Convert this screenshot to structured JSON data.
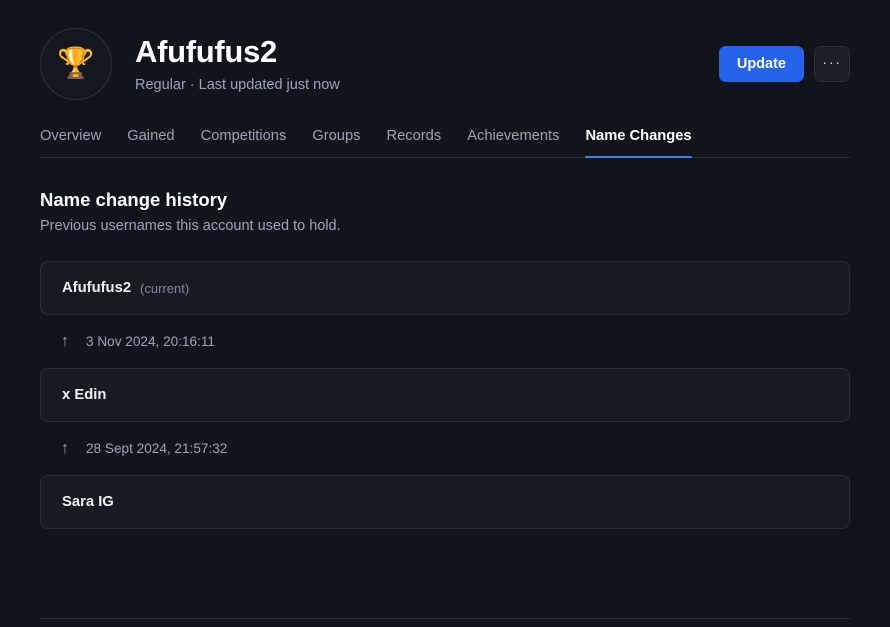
{
  "profile": {
    "avatar_icon": "trophy-icon",
    "avatar_glyph": "🏆",
    "username": "Afufufus2",
    "subtitle": "Regular · Last updated just now"
  },
  "header_actions": {
    "update_label": "Update",
    "more_label": "···",
    "more_icon": "ellipsis-icon",
    "accent_color": "#2563eb"
  },
  "tabs": [
    {
      "label": "Overview",
      "active": false
    },
    {
      "label": "Gained",
      "active": false
    },
    {
      "label": "Competitions",
      "active": false
    },
    {
      "label": "Groups",
      "active": false
    },
    {
      "label": "Records",
      "active": false
    },
    {
      "label": "Achievements",
      "active": false
    },
    {
      "label": "Name Changes",
      "active": true
    }
  ],
  "section": {
    "title": "Name change history",
    "description": "Previous usernames this account used to hold."
  },
  "history": {
    "arrow_icon": "arrow-up-icon",
    "arrow_glyph": "↑",
    "entries": [
      {
        "name": "Afufufus2",
        "tag": "(current)"
      },
      {
        "name": "x Edin",
        "tag": ""
      },
      {
        "name": "Sara IG",
        "tag": ""
      }
    ],
    "transitions": [
      {
        "date": "3 Nov 2024, 20:16:11"
      },
      {
        "date": "28 Sept 2024, 21:57:32"
      }
    ]
  },
  "theme": {
    "background": "#12141c",
    "card_background": "#171a23",
    "border": "#262b38",
    "active_tab": "#3b82f6"
  }
}
